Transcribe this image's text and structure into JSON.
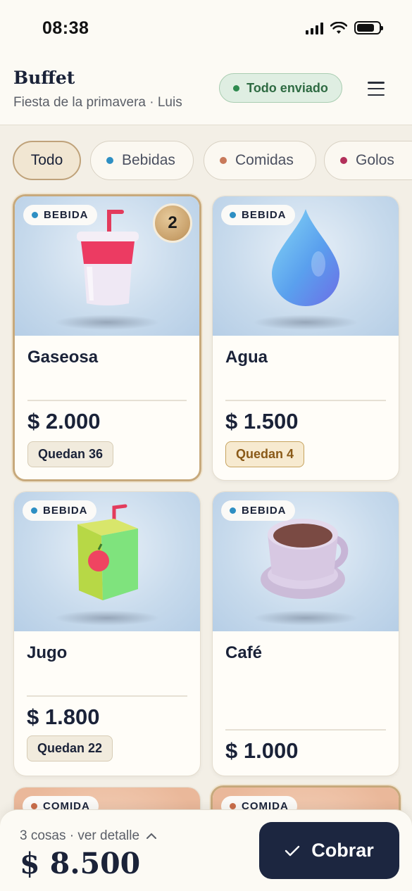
{
  "status_bar": {
    "time": "08:38"
  },
  "header": {
    "title": "Buffet",
    "subtitle": "Fiesta de la primavera · Luis",
    "sync_status": "Todo enviado"
  },
  "filters": [
    {
      "label": "Todo",
      "active": true
    },
    {
      "label": "Bebidas",
      "dot_color": "#2e8fc3"
    },
    {
      "label": "Comidas",
      "dot_color": "#c8795a"
    },
    {
      "label": "Golos",
      "dot_color": "#b2305a"
    }
  ],
  "products": [
    {
      "category": "BEBIDA",
      "name": "Gaseosa",
      "price": "$ 2.000",
      "stock": "Quedan 36",
      "in_cart": "2",
      "selected": true,
      "icon": "soda-cup-icon"
    },
    {
      "category": "BEBIDA",
      "name": "Agua",
      "price": "$ 1.500",
      "stock": "Quedan 4",
      "stock_low": true,
      "icon": "water-drop-icon"
    },
    {
      "category": "BEBIDA",
      "name": "Jugo",
      "price": "$ 1.800",
      "stock": "Quedan 22",
      "icon": "juice-box-icon"
    },
    {
      "category": "BEBIDA",
      "name": "Café",
      "price": "$ 1.000",
      "icon": "coffee-cup-icon"
    },
    {
      "category": "COMIDA",
      "icon": "food-icon"
    },
    {
      "category": "COMIDA",
      "icon": "food-icon"
    }
  ],
  "cart": {
    "summary": "3 cosas · ver detalle",
    "total": "$ 8.500",
    "checkout_label": "Cobrar"
  },
  "colors": {
    "accent_dark": "#1c2640",
    "selected_border": "#c7a97c",
    "drink_dot": "#2e8fc3",
    "food_dot": "#c96d4a",
    "sent_green": "#2f6b43"
  }
}
